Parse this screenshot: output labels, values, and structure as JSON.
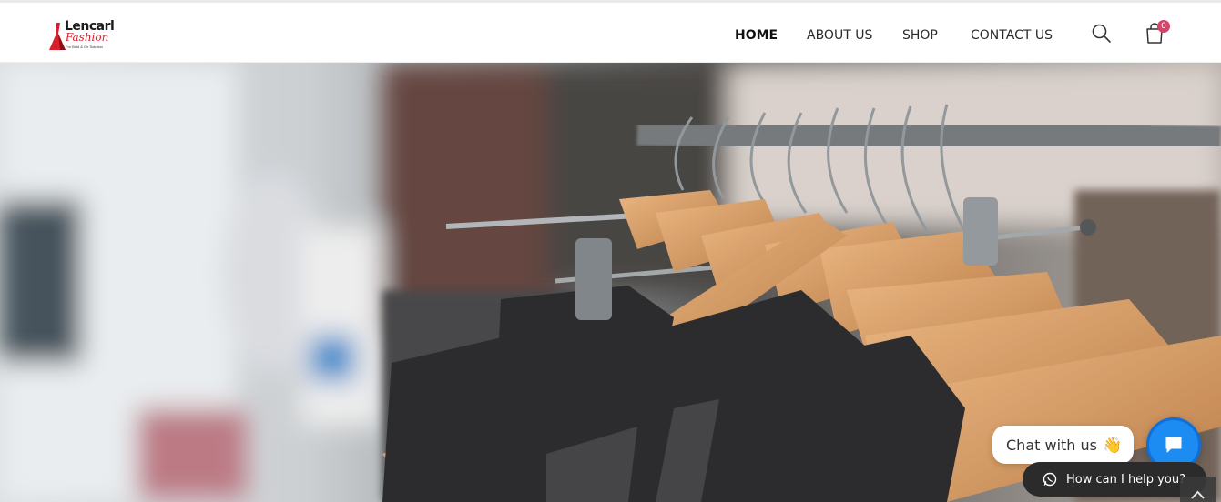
{
  "logo": {
    "word1": "Lencarl",
    "word2": "Fashion",
    "tagline": "For Bold & Gir Solution"
  },
  "nav": {
    "items": [
      {
        "label": "HOME",
        "active": true
      },
      {
        "label": "ABOUT US",
        "active": false
      },
      {
        "label": "SHOP",
        "active": false
      },
      {
        "label": "CONTACT US",
        "active": false
      }
    ]
  },
  "icons": {
    "search": "search-icon",
    "cart": "shopping-bag-icon",
    "chat": "chat-icon",
    "whatsapp": "whatsapp-icon"
  },
  "cart": {
    "count": "0"
  },
  "chat": {
    "bubble_text": "Chat with us",
    "bubble_emoji": "👋",
    "help_text": "How can I help you?"
  },
  "colors": {
    "accent_badge": "#d6436b",
    "chat_button": "#1d8cf2",
    "logo_red": "#d81f2b"
  }
}
